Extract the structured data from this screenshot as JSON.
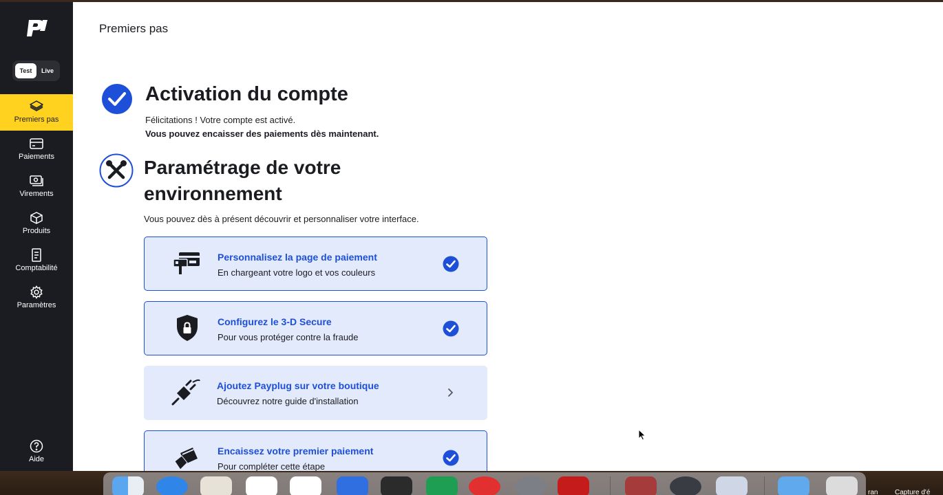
{
  "toggle": {
    "test": "Test",
    "live": "Live"
  },
  "nav": {
    "items": [
      {
        "label": "Premiers pas",
        "icon": "layers-icon",
        "active": true
      },
      {
        "label": "Paiements",
        "icon": "credit-card-icon"
      },
      {
        "label": "Virements",
        "icon": "money-transfer-icon"
      },
      {
        "label": "Produits",
        "icon": "package-icon"
      },
      {
        "label": "Comptabilité",
        "icon": "receipt-icon"
      },
      {
        "label": "Paramètres",
        "icon": "gear-icon"
      }
    ],
    "help": {
      "label": "Aide",
      "icon": "question-circle-icon"
    }
  },
  "page": {
    "title": "Premiers pas"
  },
  "activation": {
    "title": "Activation du compte",
    "text": "Félicitations ! Votre compte est activé.",
    "text_bold": "Vous pouvez encaisser des paiements dès maintenant."
  },
  "setup": {
    "title": "Paramétrage de votre environnement",
    "subtitle": "Vous pouvez dès à présent découvrir et personnaliser votre interface.",
    "cards": [
      {
        "title": "Personnalisez la page de paiement",
        "subtitle": "En chargeant votre logo et vos couleurs",
        "icon": "payment-page-brush-icon",
        "done": true
      },
      {
        "title": "Configurez le 3-D Secure",
        "subtitle": "Pour vous protéger contre la fraude",
        "icon": "shield-lock-icon",
        "done": true
      },
      {
        "title": "Ajoutez Payplug sur votre boutique",
        "subtitle": "Découvrez notre guide d'installation",
        "icon": "plug-icon",
        "done": false
      },
      {
        "title": "Encaissez votre premier paiement",
        "subtitle": "Pour compléter cette étape",
        "icon": "card-hand-icon",
        "done": true
      }
    ]
  },
  "colors": {
    "accent_yellow": "#ffd21f",
    "brand_blue": "#1d4fd8",
    "sidebar": "#1b1c21",
    "card_bg": "#e3eafb"
  },
  "dock": {
    "menu_stubs": [
      "ran",
      "Capture d'é"
    ]
  }
}
